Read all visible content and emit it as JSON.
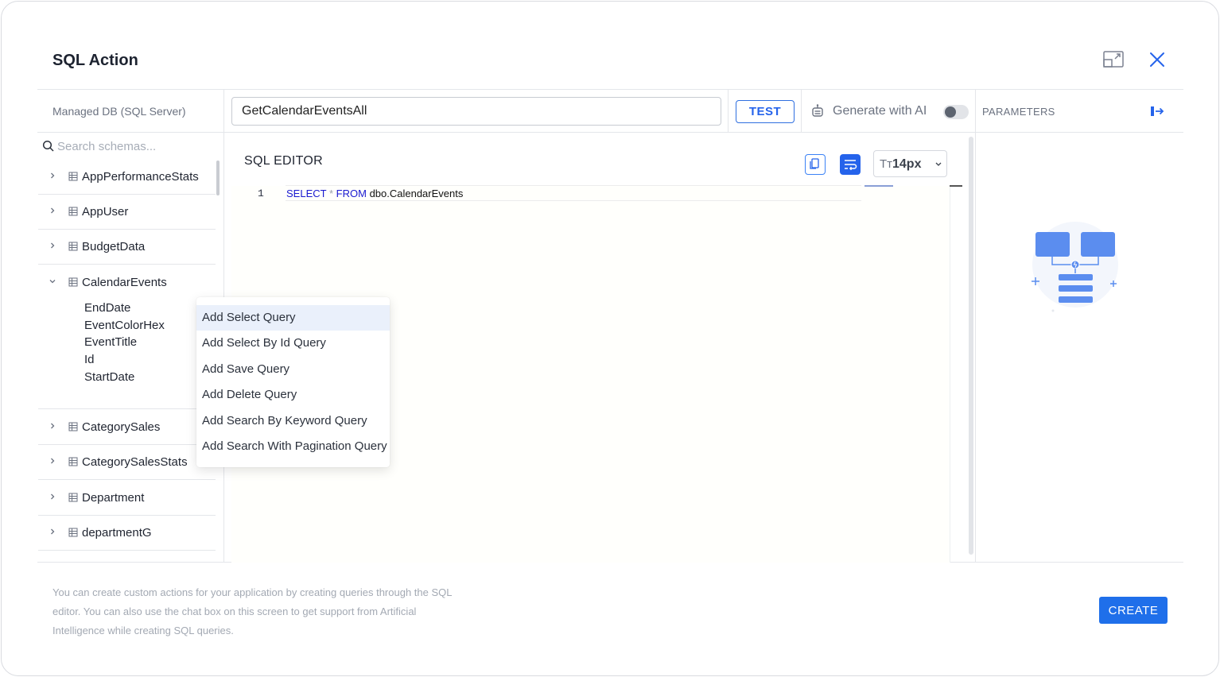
{
  "dialog": {
    "title": "SQL Action",
    "icons": {
      "expand": "expand-window-icon",
      "close": "close-icon"
    }
  },
  "toolbar": {
    "db_label": "Managed DB (SQL Server)",
    "action_name_value": "GetCalendarEventsAll",
    "test_label": "TEST",
    "ai_label": "Generate with AI",
    "ai_toggle_on": false,
    "parameters_label": "PARAMETERS"
  },
  "sidebar": {
    "search_placeholder": "Search schemas...",
    "tables": [
      {
        "label": "AppPerformanceStats",
        "expanded": false
      },
      {
        "label": "AppUser",
        "expanded": false
      },
      {
        "label": "BudgetData",
        "expanded": false
      },
      {
        "label": "CalendarEvents",
        "expanded": true,
        "columns": [
          "EndDate",
          "EventColorHex",
          "EventTitle",
          "Id",
          "StartDate"
        ]
      },
      {
        "label": "CategorySales",
        "expanded": false
      },
      {
        "label": "CategorySalesStats",
        "expanded": false
      },
      {
        "label": "Department",
        "expanded": false
      },
      {
        "label": "departmentG",
        "expanded": false
      }
    ]
  },
  "context_menu": {
    "items": [
      "Add Select Query",
      "Add Select By Id Query",
      "Add Save Query",
      "Add Delete Query",
      "Add Search By Keyword Query",
      "Add Search With Pagination Query"
    ],
    "active_index": 0
  },
  "editor": {
    "title": "SQL EDITOR",
    "font_size": "14px",
    "font_size_prefix": "Tт",
    "line_number": "1",
    "code": {
      "kw1": "SELECT",
      "op": "*",
      "kw2": "FROM",
      "rest": "dbo.CalendarEvents"
    }
  },
  "footer": {
    "info": "You can create custom actions for your application by creating queries through the SQL editor. You can also use the chat box on this screen to get support from Artificial Intelligence while creating SQL queries.",
    "create_label": "CREATE"
  },
  "colors": {
    "accent": "#2563eb",
    "keyword": "#1a1ad0",
    "illustration": "#5b8def"
  }
}
